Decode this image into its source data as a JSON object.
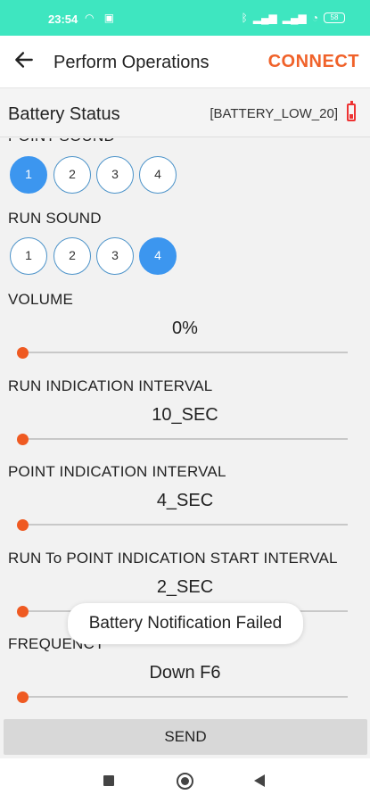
{
  "status_bar": {
    "time": "23:54",
    "battery_level": "58"
  },
  "app_bar": {
    "title": "Perform Operations",
    "connect_label": "CONNECT"
  },
  "battery": {
    "label": "Battery Status",
    "value": "[BATTERY_LOW_20]"
  },
  "point_sound": {
    "label": "POINT SOUND",
    "options": [
      "1",
      "2",
      "3",
      "4"
    ],
    "selected": "1"
  },
  "run_sound": {
    "label": "RUN SOUND",
    "options": [
      "1",
      "2",
      "3",
      "4"
    ],
    "selected": "4"
  },
  "volume": {
    "label": "VOLUME",
    "value": "0%",
    "slider_level": 0
  },
  "run_indication_interval": {
    "label": "RUN INDICATION INTERVAL",
    "value": "10_SEC",
    "slider_level": 0
  },
  "point_indication_interval": {
    "label": "POINT INDICATION INTERVAL",
    "value": "4_SEC",
    "slider_level": 0
  },
  "run_to_point_interval": {
    "label": "RUN To POINT INDICATION START INTERVAL",
    "value": "2_SEC",
    "slider_level": 0
  },
  "frequency": {
    "label": "FREQUENCY",
    "value": "Down F6",
    "slider_level": 0
  },
  "toast": {
    "message": "Battery Notification Failed"
  },
  "send_label": "SEND",
  "colors": {
    "accent": "#f0622a",
    "status_bar": "#3ee6c0",
    "selected_option": "#3c96ef",
    "slider_thumb": "#ef5a22"
  },
  "icons": {
    "back": "arrow-left-icon",
    "battery_low": "battery-low-icon",
    "nav_recents": "square-icon",
    "nav_home": "circle-icon",
    "nav_back": "triangle-back-icon"
  }
}
